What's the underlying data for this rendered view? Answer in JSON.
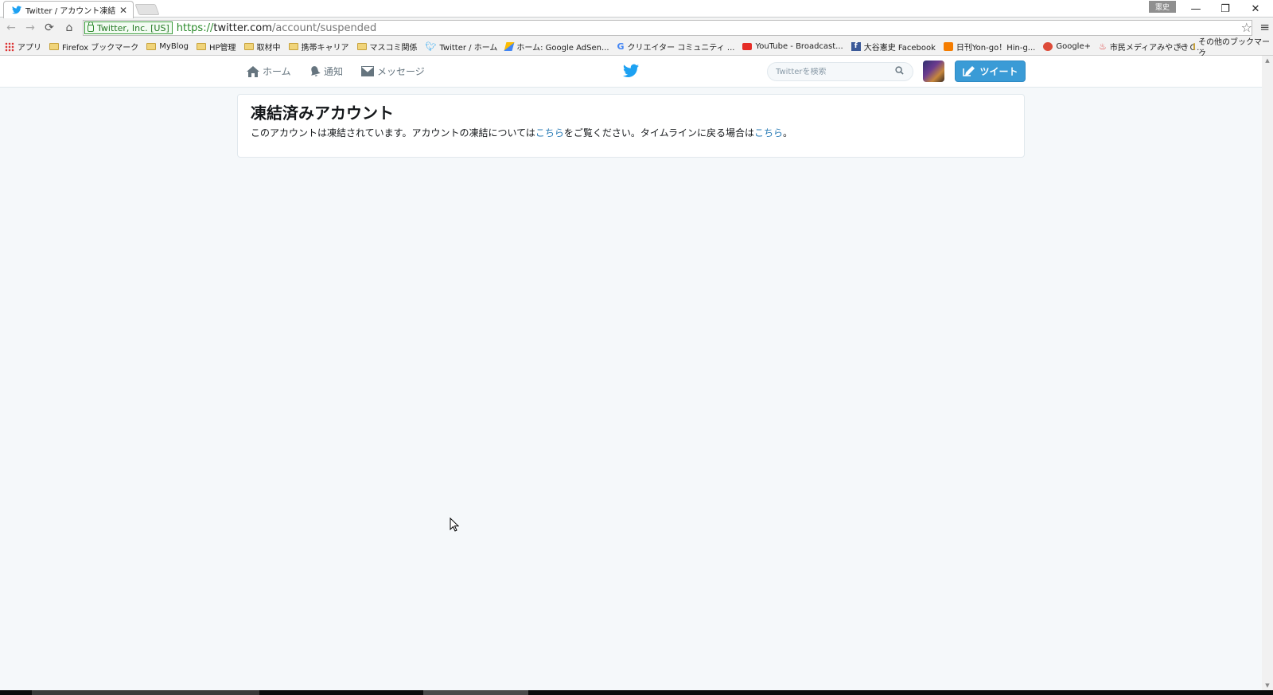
{
  "browser": {
    "tab_title": "Twitter / アカウント凍結",
    "tab_close": "✕",
    "profile_badge": "憲史",
    "window_controls": {
      "minimize": "—",
      "restore": "❐",
      "close": "✕"
    },
    "nav": {
      "back": "←",
      "forward": "→",
      "reload": "⟳",
      "home": "⌂"
    },
    "security_chip": "Twitter, Inc. [US]",
    "url": {
      "scheme": "https://",
      "host": "twitter.com",
      "path": "/account/suspended"
    },
    "bookmark_star": "☆",
    "menu_icon": "≡"
  },
  "bookmarks": {
    "items": [
      {
        "label": "アプリ",
        "icon": "apps-icon"
      },
      {
        "label": "Firefox ブックマーク",
        "icon": "folder-icon"
      },
      {
        "label": "MyBlog",
        "icon": "folder-icon"
      },
      {
        "label": "HP管理",
        "icon": "folder-icon"
      },
      {
        "label": "取材中",
        "icon": "folder-icon"
      },
      {
        "label": "携帯キャリア",
        "icon": "folder-icon"
      },
      {
        "label": "マスコミ関係",
        "icon": "folder-icon"
      },
      {
        "label": "Twitter / ホーム",
        "icon": "twitter-icon"
      },
      {
        "label": "ホーム: Google AdSen...",
        "icon": "adsense-icon"
      },
      {
        "label": "クリエイター コミュニティ ...",
        "icon": "google-icon"
      },
      {
        "label": "YouTube - Broadcast...",
        "icon": "youtube-icon"
      },
      {
        "label": "大谷憲史 Facebook",
        "icon": "facebook-icon"
      },
      {
        "label": "日刊Yon-go！Hin-g...",
        "icon": "blogger-icon"
      },
      {
        "label": "Google+",
        "icon": "google-plus-icon"
      },
      {
        "label": "市民メディアみやざきＣ...",
        "icon": "media-icon"
      }
    ],
    "more": "»",
    "other": "その他のブックマーク"
  },
  "twitter_nav": {
    "home": "ホーム",
    "notifications": "通知",
    "messages": "メッセージ",
    "search_placeholder": "Twitterを検索",
    "tweet_button": "ツイート"
  },
  "main": {
    "title": "凍結済みアカウント",
    "message_part1": "このアカウントは凍結されています。アカウントの凍結については",
    "link1": "こちら",
    "message_part2": "をご覧ください。タイムラインに戻る場合は",
    "link2": "こちら",
    "message_end": "。"
  },
  "colors": {
    "twitter_blue": "#1da1f2",
    "tweet_button": "#3a9bd6",
    "link": "#2a7bb5",
    "background": "#f5f8fa"
  }
}
